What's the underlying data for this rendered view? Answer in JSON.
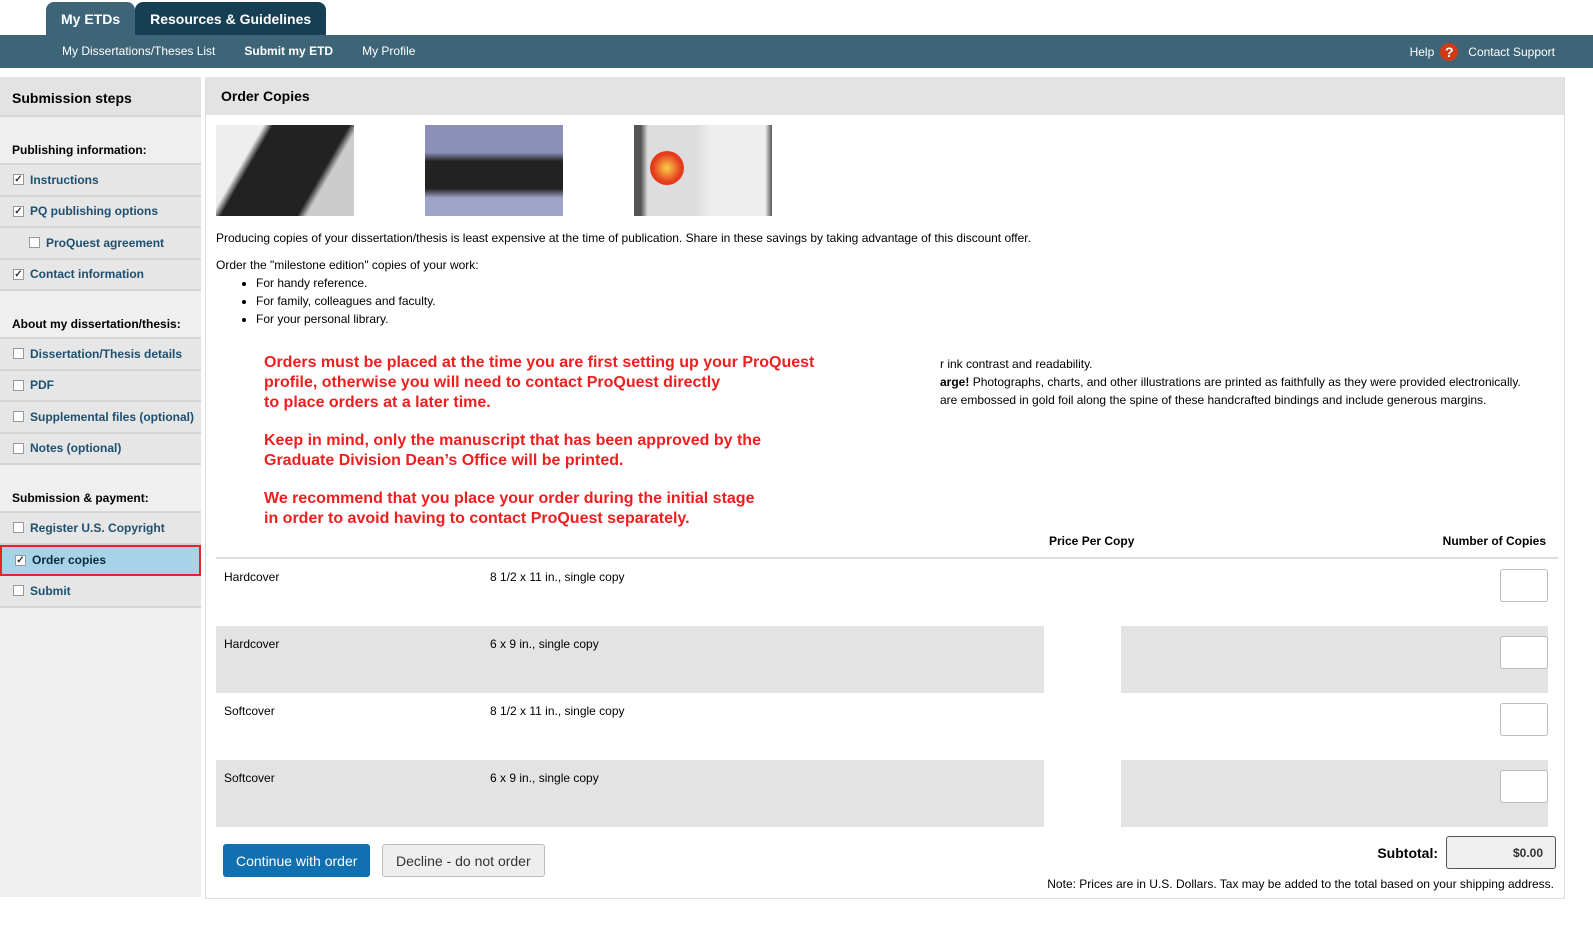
{
  "tabs": [
    {
      "label": "My ETDs"
    },
    {
      "label": "Resources & Guidelines"
    }
  ],
  "nav": {
    "links": [
      "My Dissertations/Theses List",
      "Submit my ETD",
      "My Profile"
    ],
    "help": "Help",
    "help_icon": "question-icon",
    "contact": "Contact Support"
  },
  "sidebar": {
    "title": "Submission steps",
    "groups": [
      {
        "label": "Publishing information:",
        "items": [
          {
            "label": "Instructions",
            "checked": true
          },
          {
            "label": "PQ publishing options",
            "checked": true
          },
          {
            "label": "ProQuest agreement",
            "checked": false
          },
          {
            "label": "Contact information",
            "checked": true
          }
        ]
      },
      {
        "label": "About my dissertation/thesis:",
        "items": [
          {
            "label": "Dissertation/Thesis details",
            "checked": false
          },
          {
            "label": "PDF",
            "checked": false
          },
          {
            "label": "Supplemental files (optional)",
            "checked": false
          },
          {
            "label": "Notes (optional)",
            "checked": false
          }
        ]
      },
      {
        "label": "Submission & payment:",
        "items": [
          {
            "label": "Register U.S. Copyright",
            "checked": false
          },
          {
            "label": "Order copies",
            "checked": true
          },
          {
            "label": "Submit",
            "checked": false
          }
        ]
      }
    ]
  },
  "main": {
    "title": "Order Copies",
    "intro": "Producing copies of your dissertation/thesis is least expensive at the time of publication. Share in these savings by taking advantage of this discount offer.",
    "order_intro": "Order the \"milestone edition\" copies of your work:",
    "bullets": [
      "For handy reference.",
      "For family, colleagues and faculty.",
      "For your personal library."
    ],
    "notice": [
      "Orders must be placed at the time you are first setting up your ProQuest",
      "profile, otherwise you will need to contact ProQuest directly",
      "to place orders at a later time.",
      "Keep in mind, only the manuscript that has been approved by the",
      "Graduate Division Dean’s Office will be printed.",
      "We recommend that you place your order during the initial stage",
      "in order to avoid having to contact ProQuest separately."
    ],
    "partial": [
      "r ink contrast and readability.",
      "arge!",
      "Photographs, charts, and other illustrations are printed as faithfully as they were provided electronically.",
      "are embossed in gold foil along the spine of these handcrafted bindings and include generous margins."
    ],
    "table": {
      "headers": [
        "Price Per Copy",
        "Number of Copies"
      ],
      "rows": [
        {
          "type": "Hardcover",
          "desc": "8 1/2 x 11 in., single copy"
        },
        {
          "type": "Hardcover",
          "desc": "6 x 9 in., single copy"
        },
        {
          "type": "Softcover",
          "desc": "8 1/2 x 11 in., single copy"
        },
        {
          "type": "Softcover",
          "desc": "6 x 9 in., single copy"
        }
      ]
    },
    "continue": "Continue with order",
    "decline": "Decline - do not order",
    "subtotal_label": "Subtotal:",
    "subtotal": "$0.00",
    "note": "Note: Prices are in U.S. Dollars. Tax may be added to the total based on your shipping address."
  }
}
